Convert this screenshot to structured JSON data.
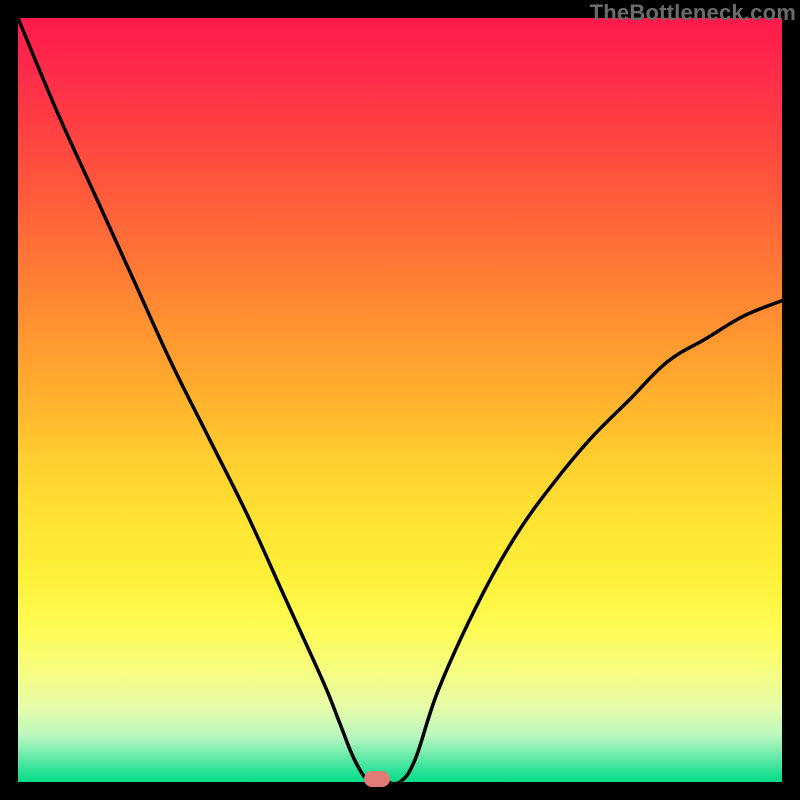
{
  "watermark": "TheBottleneck.com",
  "chart_data": {
    "type": "line",
    "title": "",
    "xlabel": "",
    "ylabel": "",
    "xlim": [
      0,
      100
    ],
    "ylim": [
      0,
      100
    ],
    "grid": false,
    "series": [
      {
        "name": "bottleneck-curve",
        "x": [
          0,
          5,
          10,
          15,
          20,
          25,
          30,
          35,
          40,
          42,
          44,
          46,
          48,
          50,
          52,
          55,
          60,
          65,
          70,
          75,
          80,
          85,
          90,
          95,
          100
        ],
        "values": [
          100,
          88,
          77,
          66,
          55,
          45,
          35,
          24,
          13,
          8,
          3,
          0,
          0,
          0,
          3,
          12,
          23,
          32,
          39,
          45,
          50,
          55,
          58,
          61,
          63
        ]
      }
    ],
    "marker": {
      "x": 47,
      "y": 0,
      "color": "#e07c78"
    },
    "background": {
      "gradient_stops": [
        {
          "pos": 0,
          "color": "#ff1a4c"
        },
        {
          "pos": 50,
          "color": "#ffab2e"
        },
        {
          "pos": 80,
          "color": "#fdfc55"
        },
        {
          "pos": 100,
          "color": "#00dd88"
        }
      ]
    }
  }
}
